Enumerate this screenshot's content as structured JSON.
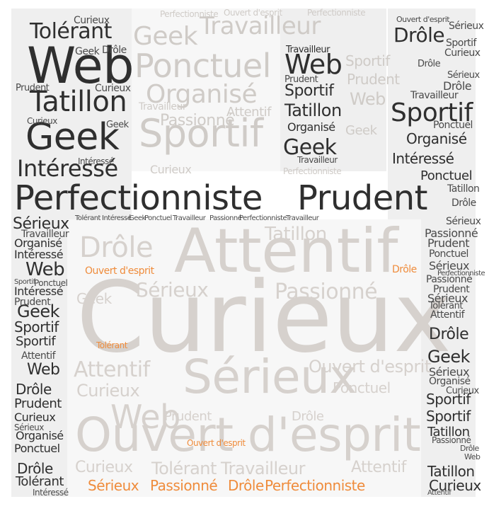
{
  "words": {
    "curieux": "Curieux",
    "web": "Web",
    "tolerant": "Tolérant",
    "tatillon": "Tatillon",
    "geek": "Geek",
    "interesse": "Intéressé",
    "perfectionniste": "Perfectionniste",
    "prudent": "Prudent",
    "travailleur": "Travailleur",
    "ponctuel": "Ponctuel",
    "organise": "Organisé",
    "sportif": "Sportif",
    "passionne": "Passionné",
    "drole": "Drôle",
    "attentif": "Attentif",
    "serieux": "Sérieux",
    "ouvert": "Ouvert d'esprit"
  },
  "colors": {
    "dark": "#2f2f2f",
    "light": "#cfcbc7",
    "beige": "#d6d1cd",
    "orange": "#ef8c3c",
    "background": "#ffffff",
    "panel": "#eeeeee"
  }
}
